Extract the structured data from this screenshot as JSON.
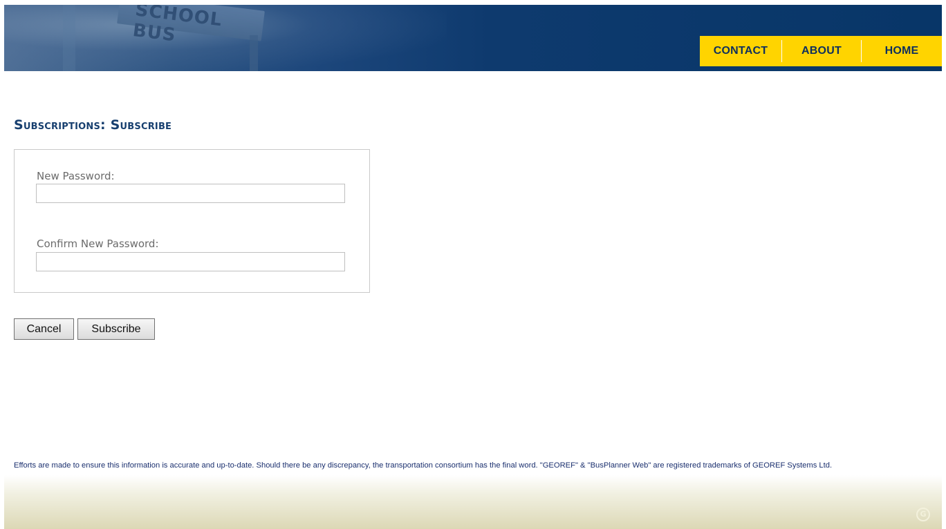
{
  "header": {
    "banner_sign_text": "SCHOOL BUS",
    "nav": {
      "contact": "CONTACT",
      "about": "ABOUT",
      "home": "HOME"
    }
  },
  "page": {
    "title": "Subscriptions: Subscribe"
  },
  "form": {
    "new_password_label": "New Password:",
    "new_password_value": "",
    "confirm_password_label": "Confirm New Password:",
    "confirm_password_value": ""
  },
  "buttons": {
    "cancel": "Cancel",
    "subscribe": "Subscribe"
  },
  "footer": {
    "disclaimer": "Efforts are made to ensure this information is accurate and up-to-date. Should there be any discrepancy, the transportation consortium has the final word. \"GEOREF\" & \"BusPlanner Web\" are registered trademarks of GEOREF Systems Ltd.",
    "logo_icon": "georef-logo-icon"
  },
  "colors": {
    "header_blue": "#083668",
    "nav_yellow": "#ffd400",
    "title_blue": "#173f6f",
    "disclaimer_blue": "#1a2f6e"
  }
}
